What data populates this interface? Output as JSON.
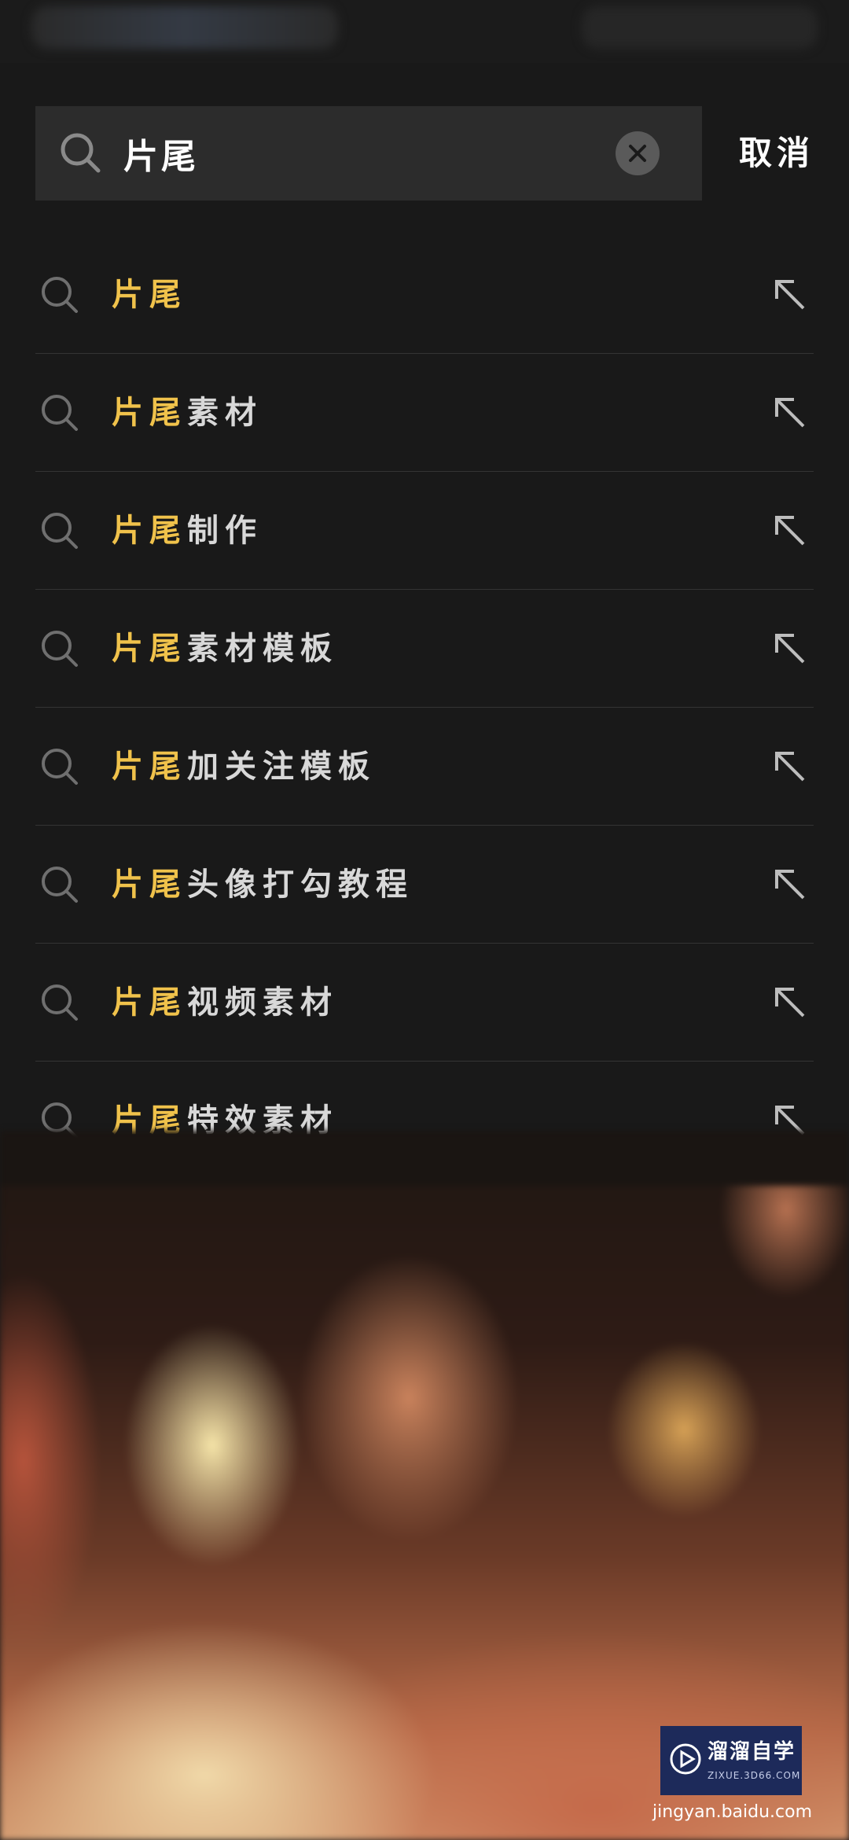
{
  "search": {
    "query": "片尾",
    "cancel_label": "取消"
  },
  "suggestions": [
    {
      "highlight": "片尾",
      "rest": ""
    },
    {
      "highlight": "片尾",
      "rest": "素材"
    },
    {
      "highlight": "片尾",
      "rest": "制作"
    },
    {
      "highlight": "片尾",
      "rest": "素材模板"
    },
    {
      "highlight": "片尾",
      "rest": "加关注模板"
    },
    {
      "highlight": "片尾",
      "rest": "头像打勾教程"
    },
    {
      "highlight": "片尾",
      "rest": "视频素材"
    },
    {
      "highlight": "片尾",
      "rest": "特效素材"
    }
  ],
  "colors": {
    "background": "#191919",
    "highlight": "#f0c24b",
    "search_box": "#2c2c2c"
  },
  "icons": {
    "search": "search-icon",
    "clear": "clear-icon",
    "fill_query": "arrow-up-left-icon"
  },
  "watermark": {
    "title": "溜溜自学",
    "subtitle": "ZIXUE.3D66.COM",
    "site": "jingyan.baidu.com"
  }
}
